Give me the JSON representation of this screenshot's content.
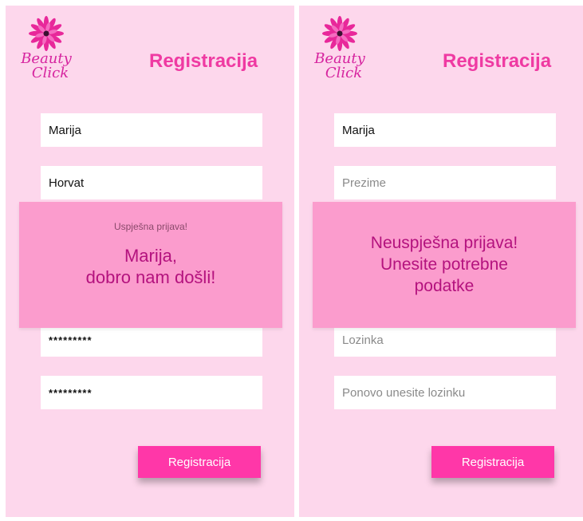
{
  "logo": {
    "line1": "Beauty",
    "line2": "Click"
  },
  "colors": {
    "background": "#fdd7ec",
    "accent": "#ef3aa2",
    "button": "#ff37a8",
    "overlay": "#fb9ccd",
    "overlay_text": "#b4127e"
  },
  "left": {
    "title": "Registracija",
    "fields": {
      "first_name": "Marija",
      "last_name": "Horvat",
      "password": "*********",
      "password_repeat": "*********"
    },
    "overlay": {
      "status": "Uspješna prijava!",
      "line1": "Marija,",
      "line2": "dobro nam došli!"
    },
    "button": "Registracija"
  },
  "right": {
    "title": "Registracija",
    "fields": {
      "first_name": "Marija",
      "last_name_placeholder": "Prezime",
      "password_placeholder": "Lozinka",
      "password_repeat_placeholder": "Ponovo unesite lozinku"
    },
    "overlay": {
      "line1": "Neuspješna prijava!",
      "line2": "Unesite potrebne",
      "line3": "podatke"
    },
    "button": "Registracija"
  }
}
